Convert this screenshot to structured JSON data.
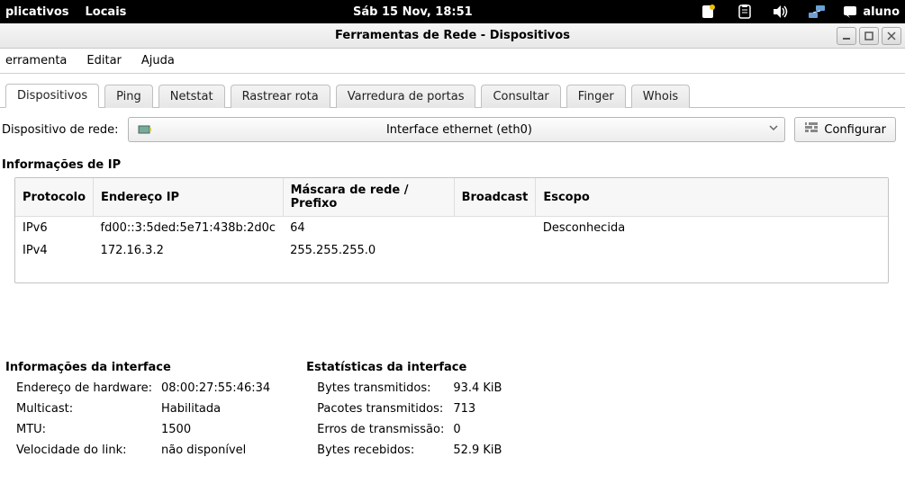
{
  "topbar": {
    "apps": "plicativos",
    "places": "Locais",
    "clock": "Sáb 15 Nov, 18:51",
    "user": "aluno"
  },
  "window": {
    "title": "Ferramentas de Rede - Dispositivos"
  },
  "menubar": {
    "tool": "erramenta",
    "edit": "Editar",
    "help": "Ajuda"
  },
  "tabs": {
    "devices": "Dispositivos",
    "ping": "Ping",
    "netstat": "Netstat",
    "traceroute": "Rastrear rota",
    "portscan": "Varredura de portas",
    "lookup": "Consultar",
    "finger": "Finger",
    "whois": "Whois"
  },
  "device_row": {
    "label": "Dispositivo de rede:",
    "selected": "Interface ethernet (eth0)",
    "configure": "Configurar"
  },
  "ip_section": {
    "title": "Informações de IP",
    "headers": {
      "protocol": "Protocolo",
      "address": "Endereço IP",
      "mask": "Máscara de rede / Prefixo",
      "broadcast": "Broadcast",
      "scope": "Escopo"
    },
    "rows": [
      {
        "protocol": "IPv6",
        "address": "fd00::3:5ded:5e71:438b:2d0c",
        "mask": "64",
        "broadcast": "",
        "scope": "Desconhecida"
      },
      {
        "protocol": "IPv4",
        "address": "172.16.3.2",
        "mask": "255.255.255.0",
        "broadcast": "",
        "scope": ""
      }
    ]
  },
  "iface_info": {
    "title": "Informações da interface",
    "hwaddr_label": "Endereço de hardware:",
    "hwaddr": "08:00:27:55:46:34",
    "multicast_label": "Multicast:",
    "multicast": "Habilitada",
    "mtu_label": "MTU:",
    "mtu": "1500",
    "linkspeed_label": "Velocidade do link:",
    "linkspeed": "não disponível"
  },
  "iface_stats": {
    "title": "Estatísticas da interface",
    "tx_bytes_label": "Bytes transmitidos:",
    "tx_bytes": "93.4 KiB",
    "tx_packets_label": "Pacotes transmitidos:",
    "tx_packets": "713",
    "tx_errors_label": "Erros de transmissão:",
    "tx_errors": "0",
    "rx_bytes_label": "Bytes recebidos:",
    "rx_bytes": "52.9 KiB"
  }
}
